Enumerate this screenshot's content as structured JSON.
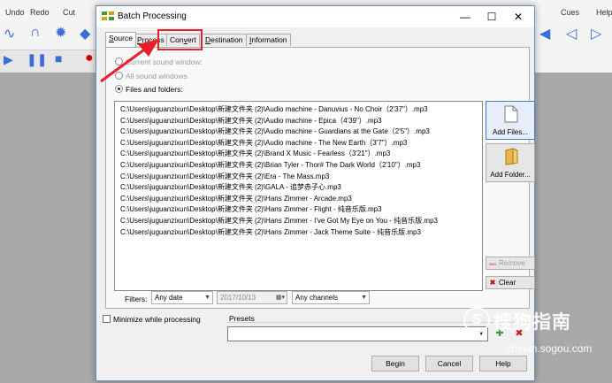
{
  "background_app": {
    "toolbar_labels": [
      "Undo",
      "Redo",
      "Cut"
    ],
    "right_tabs": [
      "Cues",
      "Help"
    ]
  },
  "dialog": {
    "title": "Batch Processing",
    "tabs": [
      {
        "label": "Source",
        "underline": "S",
        "rest": "ource"
      },
      {
        "label": "Process",
        "underline": "P",
        "rest": "rocess"
      },
      {
        "label": "Convert",
        "pre": "Con",
        "underline": "v",
        "rest": "ert"
      },
      {
        "label": "Destination",
        "underline": "D",
        "rest": "estination"
      },
      {
        "label": "Information",
        "underline": "I",
        "rest": "nformation"
      }
    ],
    "radios": {
      "current_window": "Current sound window:",
      "all_windows": "All sound windows",
      "files_folders": "Files and folders:"
    },
    "files": [
      "C:\\Users\\juguanzixun\\Desktop\\新建文件夹 (2)\\Audio machine - Danuvius - No Choir（2'37\"）.mp3",
      "C:\\Users\\juguanzixun\\Desktop\\新建文件夹 (2)\\Audio machine - Epica（4'39\"）.mp3",
      "C:\\Users\\juguanzixun\\Desktop\\新建文件夹 (2)\\Audio machine - Guardians at the Gate（2'5\"）.mp3",
      "C:\\Users\\juguanzixun\\Desktop\\新建文件夹 (2)\\Audio machine - The New Earth（3'7\"）.mp3",
      "C:\\Users\\juguanzixun\\Desktop\\新建文件夹 (2)\\Brand X Music - Fearless（3'21\"）.mp3",
      "C:\\Users\\juguanzixun\\Desktop\\新建文件夹 (2)\\Brian Tyler - Thor# The Dark World（2'10\"）.mp3",
      "C:\\Users\\juguanzixun\\Desktop\\新建文件夹 (2)\\Era - The Mass.mp3",
      "C:\\Users\\juguanzixun\\Desktop\\新建文件夹 (2)\\GALA - 追梦赤子心.mp3",
      "C:\\Users\\juguanzixun\\Desktop\\新建文件夹 (2)\\Hans Zimmer - Arcade.mp3",
      "C:\\Users\\juguanzixun\\Desktop\\新建文件夹 (2)\\Hans Zimmer - Flight - 纯音乐版.mp3",
      "C:\\Users\\juguanzixun\\Desktop\\新建文件夹 (2)\\Hans Zimmer - I've Got My Eye on You - 纯音乐版.mp3",
      "C:\\Users\\juguanzixun\\Desktop\\新建文件夹 (2)\\Hans Zimmer - Jack Theme Suite - 纯音乐版.mp3"
    ],
    "buttons": {
      "add_files": "Add Files...",
      "add_folder": "Add Folder...",
      "remove": "Remove",
      "clear": "Clear",
      "begin": "Begin",
      "cancel": "Cancel",
      "help": "Help"
    },
    "filters": {
      "label": "Filters:",
      "date_mode": "Any date",
      "date_value": "2017/10/13",
      "channels": "Any channels"
    },
    "minimize_label": "Minimize while processing",
    "presets_label": "Presets",
    "presets_value": ""
  },
  "watermark": {
    "logo_glyph": "S",
    "name": "搜狗指南",
    "url": "zhinan.sogou.com"
  },
  "colors": {
    "highlight": "#e8202a",
    "primary_button_border": "#3c7fd5"
  }
}
